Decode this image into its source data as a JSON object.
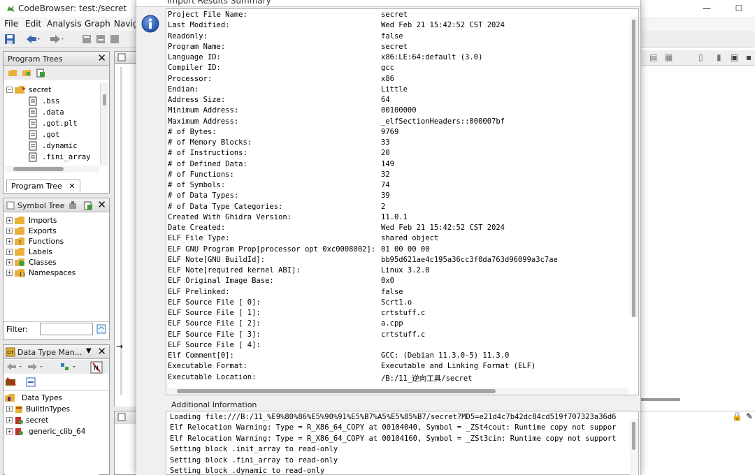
{
  "window": {
    "title": "CodeBrowser: test:/secret",
    "minimize": "—",
    "maximize": "☐"
  },
  "menu": [
    "File",
    "Edit",
    "Analysis",
    "Graph",
    "Navig"
  ],
  "program_trees": {
    "title": "Program Trees",
    "tab_label": "Program Tree",
    "root": "secret",
    "items": [
      ".bss",
      ".data",
      ".got.plt",
      ".got",
      ".dynamic",
      ".fini_array"
    ]
  },
  "symbol_tree": {
    "title": "Symbol Tree",
    "items": [
      "Imports",
      "Exports",
      "Functions",
      "Labels",
      "Classes",
      "Namespaces"
    ],
    "filter_label": "Filter:"
  },
  "data_type_manager": {
    "title": "Data Type Man...",
    "root": "Data Types",
    "items": [
      "BuiltInTypes",
      "secret",
      "generic_clib_64"
    ]
  },
  "dialog": {
    "title": "Import Results Summary",
    "summary": [
      {
        "k": "Project File Name:",
        "v": "secret"
      },
      {
        "k": "Last Modified:",
        "v": "Wed Feb 21 15:42:52 CST 2024"
      },
      {
        "k": "Readonly:",
        "v": "false"
      },
      {
        "k": "Program Name:",
        "v": "secret"
      },
      {
        "k": "Language ID:",
        "v": "x86:LE:64:default (3.0)"
      },
      {
        "k": "Compiler ID:",
        "v": "gcc"
      },
      {
        "k": "Processor:",
        "v": "x86"
      },
      {
        "k": "Endian:",
        "v": "Little"
      },
      {
        "k": "Address Size:",
        "v": "64"
      },
      {
        "k": "Minimum Address:",
        "v": "00100000"
      },
      {
        "k": "Maximum Address:",
        "v": "_elfSectionHeaders::000007bf"
      },
      {
        "k": "# of Bytes:",
        "v": "9769"
      },
      {
        "k": "# of Memory Blocks:",
        "v": "33"
      },
      {
        "k": "# of Instructions:",
        "v": "20"
      },
      {
        "k": "# of Defined Data:",
        "v": "149"
      },
      {
        "k": "# of Functions:",
        "v": "32"
      },
      {
        "k": "# of Symbols:",
        "v": "74"
      },
      {
        "k": "# of Data Types:",
        "v": "39"
      },
      {
        "k": "# of Data Type Categories:",
        "v": "2"
      },
      {
        "k": "Created With Ghidra Version:",
        "v": "11.0.1"
      },
      {
        "k": "Date Created:",
        "v": "Wed Feb 21 15:42:52 CST 2024"
      },
      {
        "k": "ELF File Type:",
        "v": "shared object"
      },
      {
        "k": "ELF GNU Program Prop[processor opt 0xc0008002]:",
        "v": "01 00 00 00"
      },
      {
        "k": "ELF Note[GNU BuildId]:",
        "v": "bb95d621ae4c195a36cc3f0da763d96099a3c7ae"
      },
      {
        "k": "ELF Note[required kernel ABI]:",
        "v": "Linux 3.2.0"
      },
      {
        "k": "ELF Original Image Base:",
        "v": "0x0"
      },
      {
        "k": "ELF Prelinked:",
        "v": "false"
      },
      {
        "k": "ELF Source File [   0]:",
        "v": "Scrt1.o"
      },
      {
        "k": "ELF Source File [   1]:",
        "v": "crtstuff.c"
      },
      {
        "k": "ELF Source File [   2]:",
        "v": "a.cpp"
      },
      {
        "k": "ELF Source File [   3]:",
        "v": "crtstuff.c"
      },
      {
        "k": "ELF Source File [   4]:",
        "v": ""
      },
      {
        "k": "Elf Comment[0]:",
        "v": "GCC: (Debian 11.3.0-5) 11.3.0"
      },
      {
        "k": "Executable Format:",
        "v": "Executable and Linking Format (ELF)"
      },
      {
        "k": "Executable Location:",
        "v": "/B:/11_逆向工具/secret"
      }
    ],
    "additional_label": "Additional Information",
    "additional": [
      "Loading file:///B:/11_%E9%80%86%E5%90%91%E5%B7%A5%E5%85%B7/secret?MD5=e21d4c7b42dc84cd519f707323a36d6",
      "Elf Relocation Warning: Type = R_X86_64_COPY at 00104040, Symbol = _ZSt4cout: Runtime copy not suppor",
      "Elf Relocation Warning: Type = R_X86_64_COPY at 00104160, Symbol = _ZSt3cin: Runtime copy not support",
      "Setting block .init_array to read-only",
      "Setting block .fini_array to read-only",
      "Setting block .dynamic to read-only"
    ]
  },
  "colors": {
    "accent_blue": "#2f5fb8",
    "folder_yellow": "#e8b23a",
    "panel_bg": "#ffffff",
    "dialog_bg": "#f0f0f0"
  }
}
